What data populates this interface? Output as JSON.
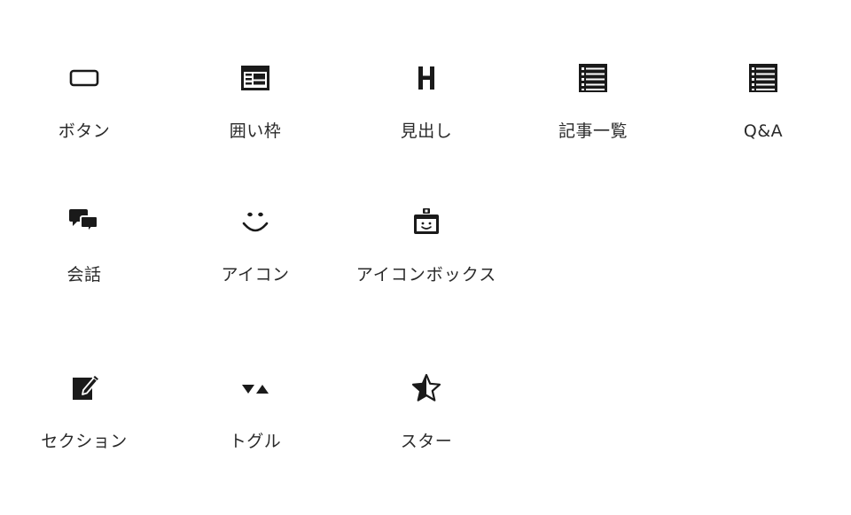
{
  "blocks": [
    {
      "id": "button",
      "label": "ボタン",
      "icon": "button-icon"
    },
    {
      "id": "box",
      "label": "囲い枠",
      "icon": "framed-box-icon"
    },
    {
      "id": "heading",
      "label": "見出し",
      "icon": "heading-icon"
    },
    {
      "id": "article-list",
      "label": "記事一覧",
      "icon": "list-icon"
    },
    {
      "id": "qa",
      "label": "Q&A",
      "icon": "list-icon"
    },
    {
      "id": "conversation",
      "label": "会話",
      "icon": "speech-bubbles-icon"
    },
    {
      "id": "icon",
      "label": "アイコン",
      "icon": "smiley-icon"
    },
    {
      "id": "iconbox",
      "label": "アイコンボックス",
      "icon": "badge-icon"
    },
    {
      "id": "section",
      "label": "セクション",
      "icon": "edit-note-icon"
    },
    {
      "id": "toggle",
      "label": "トグル",
      "icon": "toggle-triangles-icon"
    },
    {
      "id": "star",
      "label": "スター",
      "icon": "half-star-icon"
    }
  ]
}
